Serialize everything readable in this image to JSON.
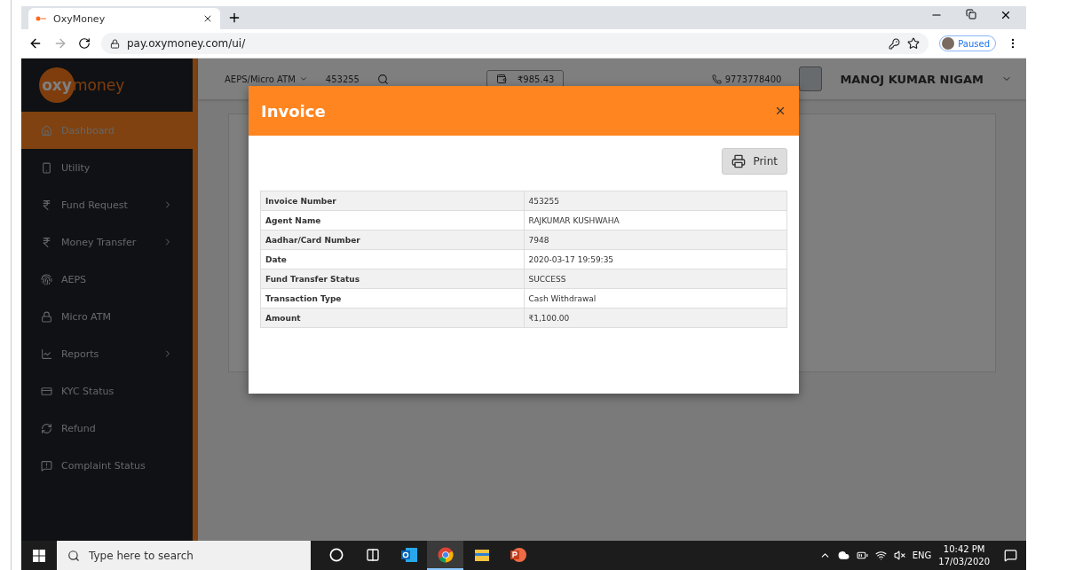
{
  "browser": {
    "tab_title": "OxyMoney",
    "url": "pay.oxymoney.com/ui/",
    "profile_badge": "Paused"
  },
  "logo": {
    "first": "oxy",
    "second": "money"
  },
  "header": {
    "service": "AEPS/Micro ATM",
    "invoice_search": "453255",
    "balance": "₹985.43",
    "phone": "9773778400",
    "user_name": "MANOJ KUMAR NIGAM"
  },
  "sidebar": {
    "items": [
      {
        "label": "Dashboard",
        "selected": true,
        "has_submenu": false
      },
      {
        "label": "Utility",
        "selected": false,
        "has_submenu": false
      },
      {
        "label": "Fund Request",
        "selected": false,
        "has_submenu": true
      },
      {
        "label": "Money Transfer",
        "selected": false,
        "has_submenu": true
      },
      {
        "label": "AEPS",
        "selected": false,
        "has_submenu": false
      },
      {
        "label": "Micro ATM",
        "selected": false,
        "has_submenu": false
      },
      {
        "label": "Reports",
        "selected": false,
        "has_submenu": true
      },
      {
        "label": "KYC Status",
        "selected": false,
        "has_submenu": false
      },
      {
        "label": "Refund",
        "selected": false,
        "has_submenu": false
      },
      {
        "label": "Complaint Status",
        "selected": false,
        "has_submenu": false
      }
    ]
  },
  "modal": {
    "title": "Invoice",
    "print_button": "Print",
    "rows": [
      {
        "label": "Invoice Number",
        "value": "453255"
      },
      {
        "label": "Agent Name",
        "value": "RAJKUMAR KUSHWAHA"
      },
      {
        "label": "Aadhar/Card Number",
        "value": "7948"
      },
      {
        "label": "Date",
        "value": "2020-03-17 19:59:35"
      },
      {
        "label": "Fund Transfer Status",
        "value": "SUCCESS"
      },
      {
        "label": "Transaction Type",
        "value": "Cash Withdrawal"
      },
      {
        "label": "Amount",
        "value": "₹1,100.00"
      }
    ]
  },
  "taskbar": {
    "search_placeholder": "Type here to search",
    "apps": [
      {
        "kind": "cortana",
        "selected": false
      },
      {
        "kind": "task-view",
        "selected": false
      },
      {
        "kind": "outlook",
        "selected": false
      },
      {
        "kind": "chrome",
        "selected": true
      },
      {
        "kind": "files",
        "selected": false
      },
      {
        "kind": "powerpoint",
        "selected": false
      }
    ],
    "language": "ENG",
    "time": "10:42 PM",
    "date": "17/03/2020"
  }
}
